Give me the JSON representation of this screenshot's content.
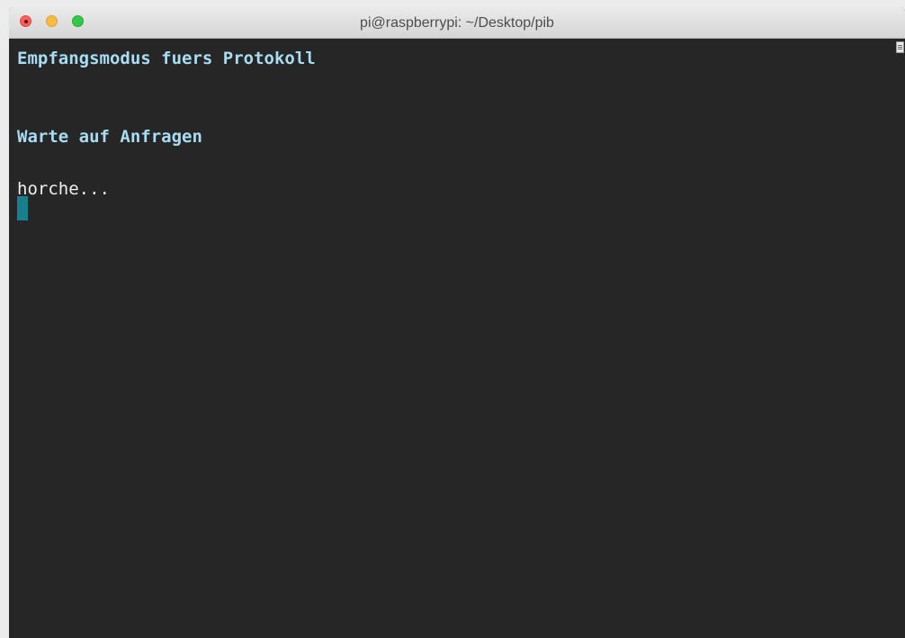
{
  "window": {
    "title": "pi@raspberrypi: ~/Desktop/pib"
  },
  "terminal": {
    "lines": [
      "Empfangsmodus fuers Protokoll",
      "",
      "",
      "Warte auf Anfragen",
      "",
      "horche..."
    ],
    "colors": {
      "background": "#262626",
      "info_text": "#a8dcf2",
      "plain_text": "#f0f0f0",
      "cursor": "#15808e"
    }
  }
}
